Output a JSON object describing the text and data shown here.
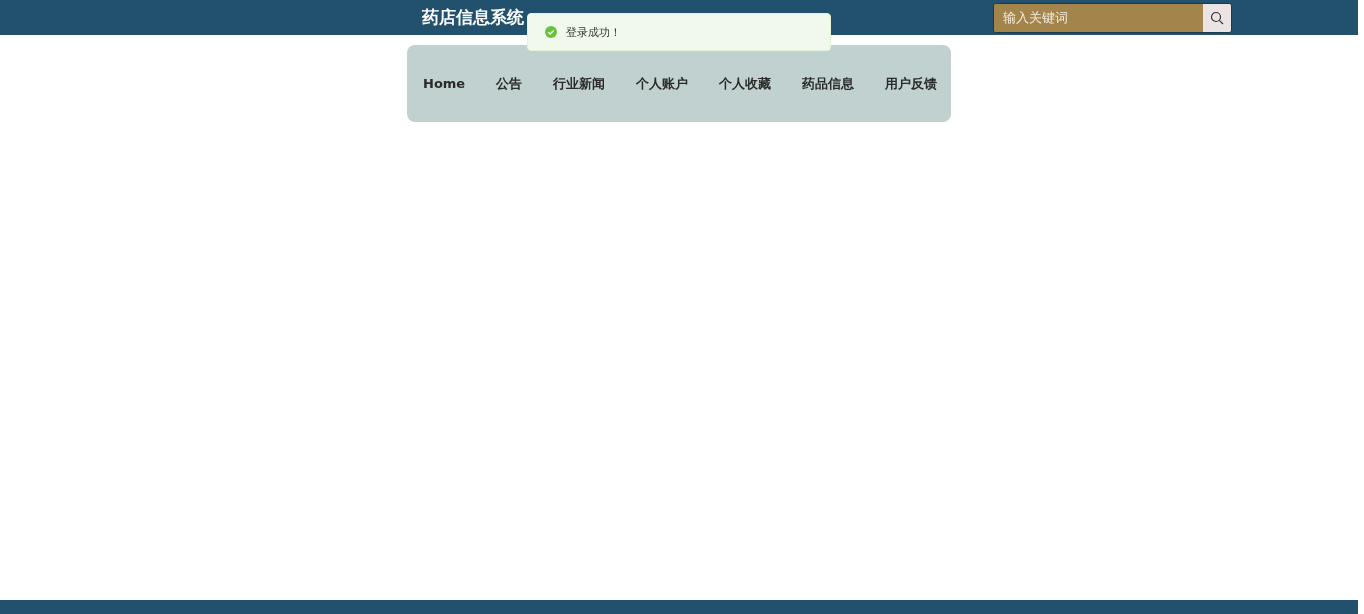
{
  "header": {
    "title": "药店信息系统",
    "search": {
      "placeholder": "输入关键词"
    }
  },
  "toast": {
    "kind": "success",
    "message": "登录成功！"
  },
  "nav": [
    {
      "label": "Home"
    },
    {
      "label": "公告"
    },
    {
      "label": "行业新闻"
    },
    {
      "label": "个人账户"
    },
    {
      "label": "个人收藏"
    },
    {
      "label": "药品信息"
    },
    {
      "label": "用户反馈"
    }
  ]
}
